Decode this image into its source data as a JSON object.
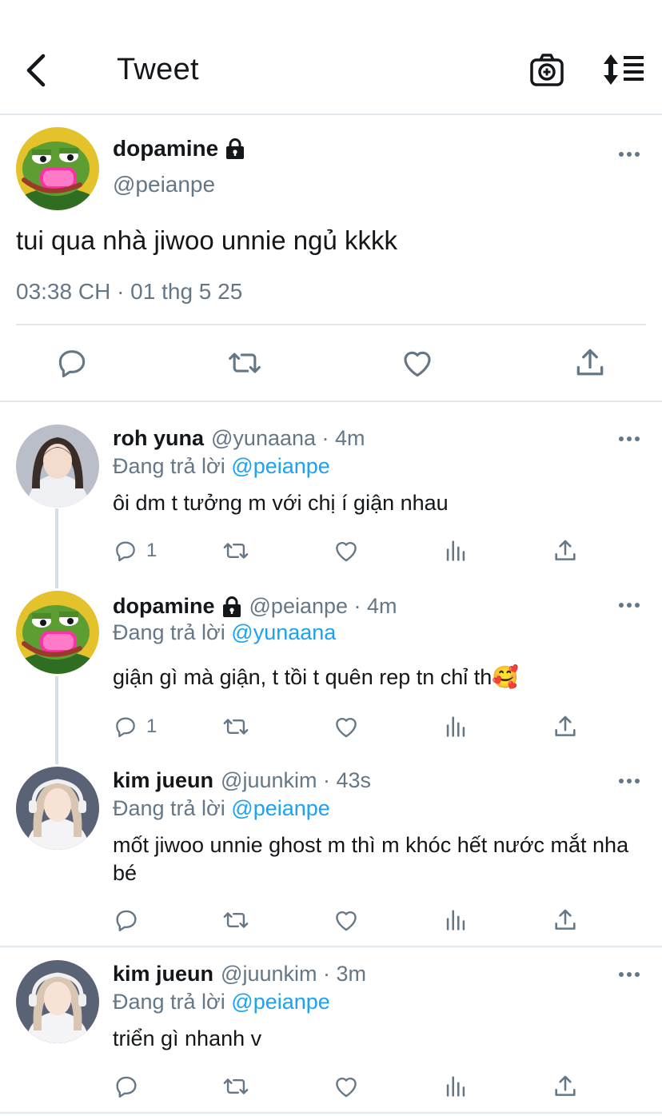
{
  "header": {
    "title": "Tweet",
    "icons": [
      "back-arrow-icon",
      "camera-plus-icon",
      "sort-icon"
    ]
  },
  "main_tweet": {
    "name": "dopamine",
    "handle": "@peianpe",
    "text": "tui qua nhà jiwoo unnie ngủ kkkk",
    "timestamp": "03:38 CH · 01 thg 5 25",
    "icons": [
      "reply-icon",
      "retweet-icon",
      "like-icon",
      "share-icon"
    ]
  },
  "replies": [
    {
      "name": "roh yuna",
      "meta": "@yunaana · 4m",
      "replying_prefix": "Đang trả lời",
      "replying_to": "@peianpe",
      "text": "ôi dm t tưởng m với chị í giận nhau",
      "reply_count": "1"
    },
    {
      "name": "dopamine",
      "meta": "@peianpe · 4m",
      "replying_prefix": "Đang trả lời",
      "replying_to": "@yunaana",
      "text": "giận gì mà giận, t tồi t quên rep tn chỉ th🥰",
      "reply_count": "1"
    },
    {
      "name": "kim jueun",
      "meta": "@juunkim · 43s",
      "replying_prefix": "Đang trả lời",
      "replying_to": "@peianpe",
      "text": "mốt jiwoo unnie ghost m thì m khóc hết nước mắt nha bé",
      "reply_count": ""
    },
    {
      "name": "kim jueun",
      "meta": "@juunkim · 3m",
      "replying_prefix": "Đang trả lời",
      "replying_to": "@peianpe",
      "text": "triển gì nhanh v",
      "reply_count": ""
    }
  ],
  "colors": {
    "text": "#14171a",
    "secondary": "#657786",
    "link": "#1da1f2",
    "divider": "#e1e8ed"
  }
}
